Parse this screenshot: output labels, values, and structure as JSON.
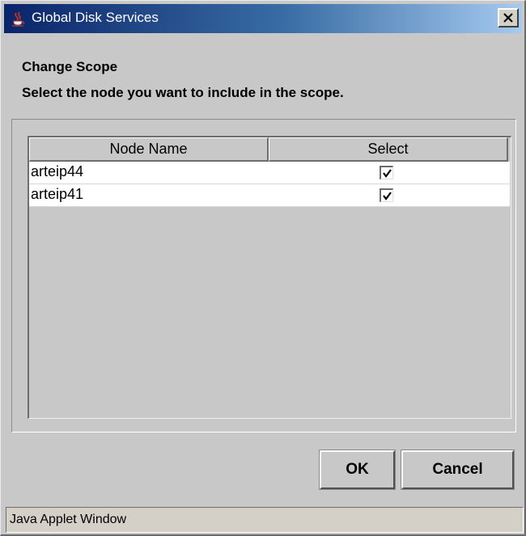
{
  "window": {
    "title": "Global Disk Services",
    "title_icon": "java-coffee-icon",
    "close_icon": "close-icon"
  },
  "dialog": {
    "heading": "Change Scope",
    "instruction": "Select the node you want to include in the scope."
  },
  "table": {
    "columns": [
      "Node Name",
      "Select"
    ],
    "rows": [
      {
        "name": "arteip44",
        "selected": true
      },
      {
        "name": "arteip41",
        "selected": true
      }
    ]
  },
  "buttons": {
    "ok_label": "OK",
    "cancel_label": "Cancel"
  },
  "status": {
    "text": "Java Applet Window"
  },
  "colors": {
    "titlebar_start": "#0a246a",
    "titlebar_end": "#a6caf0",
    "background": "#c8c8c8"
  }
}
